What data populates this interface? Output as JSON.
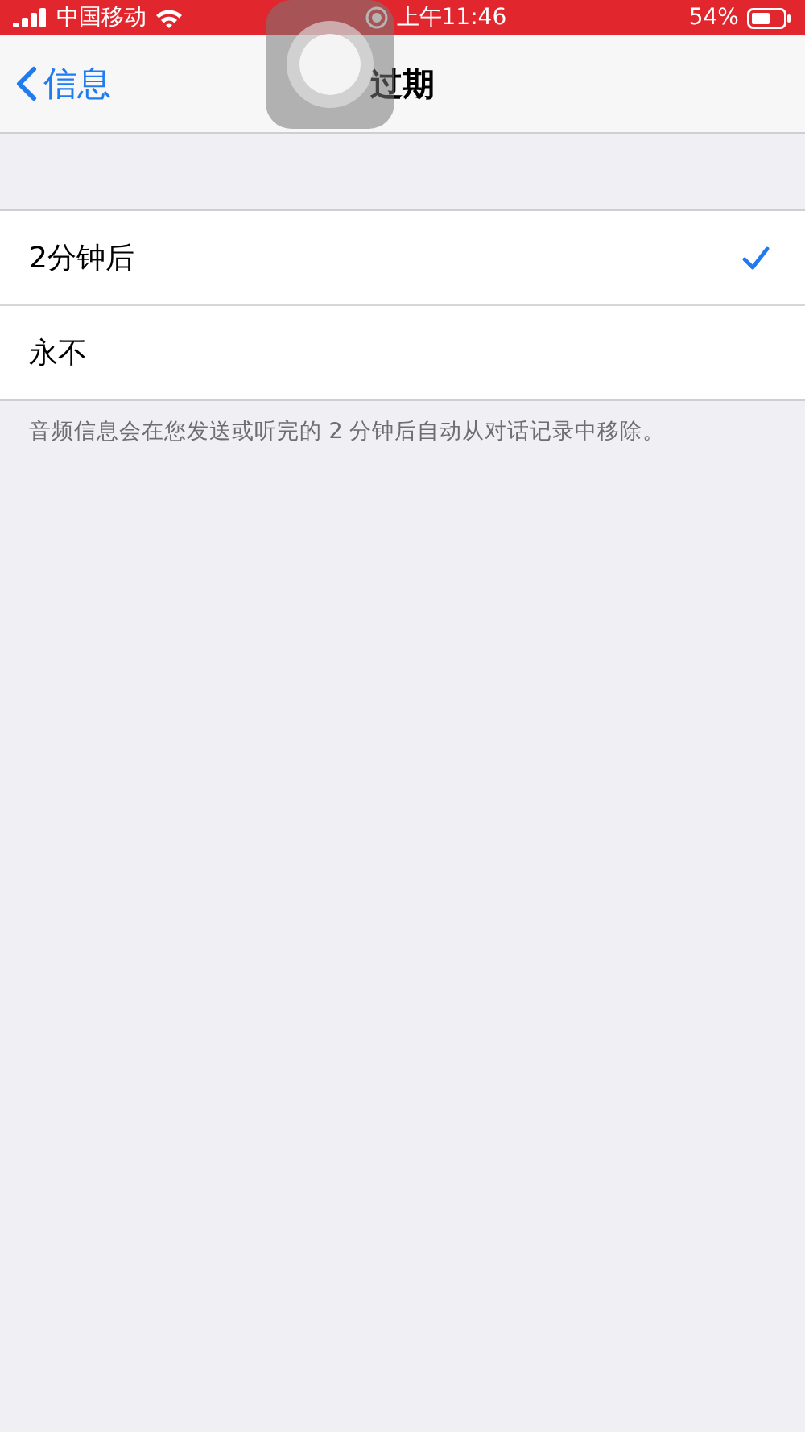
{
  "status_bar": {
    "carrier": "中国移动",
    "time": "上午11:46",
    "battery": "54%"
  },
  "nav": {
    "back": "信息",
    "title": "过期"
  },
  "options": [
    {
      "label": "2分钟后",
      "selected": true
    },
    {
      "label": "永不",
      "selected": false
    }
  ],
  "footer": "音频信息会在您发送或听完的 2 分钟后自动从对话记录中移除。"
}
